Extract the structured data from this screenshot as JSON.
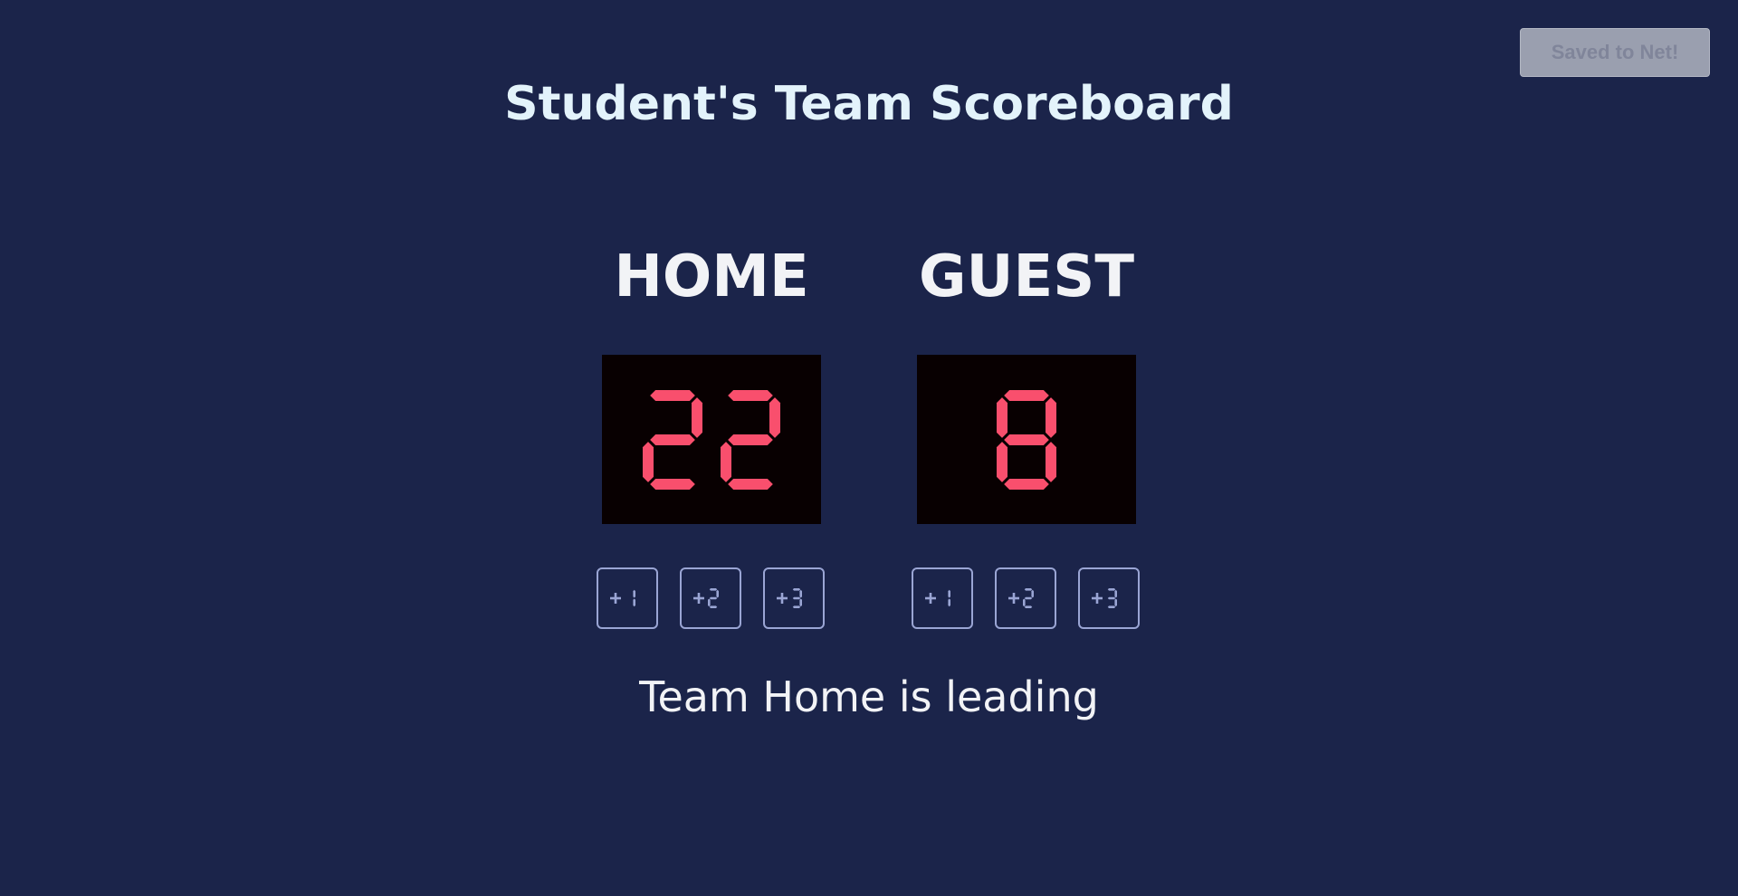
{
  "header": {
    "save_button_label": "Saved to Net!",
    "title": "Student's Team Scoreboard"
  },
  "home": {
    "label": "HOME",
    "score": "22",
    "buttons": [
      "+1",
      "+2",
      "+3"
    ]
  },
  "guest": {
    "label": "GUEST",
    "score": "8",
    "buttons": [
      "+1",
      "+2",
      "+3"
    ]
  },
  "status": "Team Home is leading",
  "colors": {
    "background": "#1b244a",
    "digit": "#f94f6d",
    "display_bg": "#080001",
    "button_border": "#9aa5d4",
    "button_text": "#9aa5d4"
  }
}
